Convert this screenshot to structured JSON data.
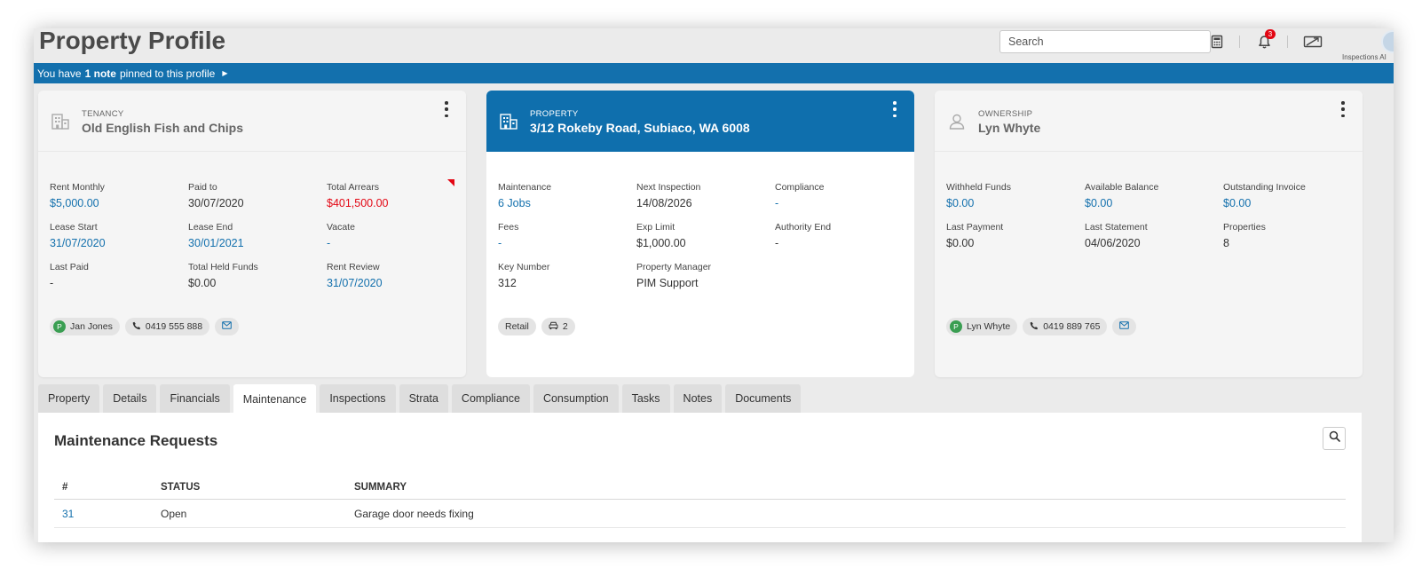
{
  "header": {
    "title": "Property Profile",
    "search_placeholder": "Search",
    "notification_count": "3",
    "inspections_label": "Inspections AI"
  },
  "pin_bar": {
    "prefix": "You have",
    "count_text": "1 note",
    "suffix": "pinned to this profile"
  },
  "cards": {
    "tenancy": {
      "type": "TENANCY",
      "name": "Old English Fish and Chips",
      "fields": [
        {
          "label": "Rent Monthly",
          "value": "$5,000.00"
        },
        {
          "label": "Paid to",
          "value": "30/07/2020"
        },
        {
          "label": "Total Arrears",
          "value": "$401,500.00"
        },
        {
          "label": "Lease Start",
          "value": "31/07/2020"
        },
        {
          "label": "Lease End",
          "value": "30/01/2021"
        },
        {
          "label": "Vacate",
          "value": "-"
        },
        {
          "label": "Last Paid",
          "value": "-"
        },
        {
          "label": "Total Held Funds",
          "value": "$0.00"
        },
        {
          "label": "Rent Review",
          "value": "31/07/2020"
        }
      ],
      "contact_initial": "P",
      "contact_name": "Jan Jones",
      "contact_phone": "0419 555 888"
    },
    "property": {
      "type": "PROPERTY",
      "name": "3/12 Rokeby Road, Subiaco, WA 6008",
      "fields": [
        {
          "label": "Maintenance",
          "value": "6 Jobs"
        },
        {
          "label": "Next Inspection",
          "value": "14/08/2026"
        },
        {
          "label": "Compliance",
          "value": "-"
        },
        {
          "label": "Fees",
          "value": "-"
        },
        {
          "label": "Exp Limit",
          "value": "$1,000.00"
        },
        {
          "label": "Authority End",
          "value": "-"
        },
        {
          "label": "Key Number",
          "value": "312"
        },
        {
          "label": "Property Manager",
          "value": "PIM Support"
        }
      ],
      "tag_type": "Retail",
      "car_spaces": "2"
    },
    "ownership": {
      "type": "OWNERSHIP",
      "name": "Lyn Whyte",
      "fields": [
        {
          "label": "Withheld Funds",
          "value": "$0.00"
        },
        {
          "label": "Available Balance",
          "value": "$0.00"
        },
        {
          "label": "Outstanding Invoice",
          "value": "$0.00"
        },
        {
          "label": "Last Payment",
          "value": "$0.00"
        },
        {
          "label": "Last Statement",
          "value": "04/06/2020"
        },
        {
          "label": "Properties",
          "value": "8"
        }
      ],
      "contact_initial": "P",
      "contact_name": "Lyn Whyte",
      "contact_phone": "0419 889 765"
    }
  },
  "tabs": [
    "Property",
    "Details",
    "Financials",
    "Maintenance",
    "Inspections",
    "Strata",
    "Compliance",
    "Consumption",
    "Tasks",
    "Notes",
    "Documents"
  ],
  "active_tab": "Maintenance",
  "maintenance": {
    "title": "Maintenance Requests",
    "columns": [
      "#",
      "STATUS",
      "SUMMARY"
    ],
    "rows": [
      {
        "id": "31",
        "status": "Open",
        "summary": "Garage door needs fixing"
      }
    ]
  },
  "colors": {
    "brand_blue": "#1370ad",
    "alert_red": "#e30613",
    "contact_green": "#3a9e52"
  }
}
